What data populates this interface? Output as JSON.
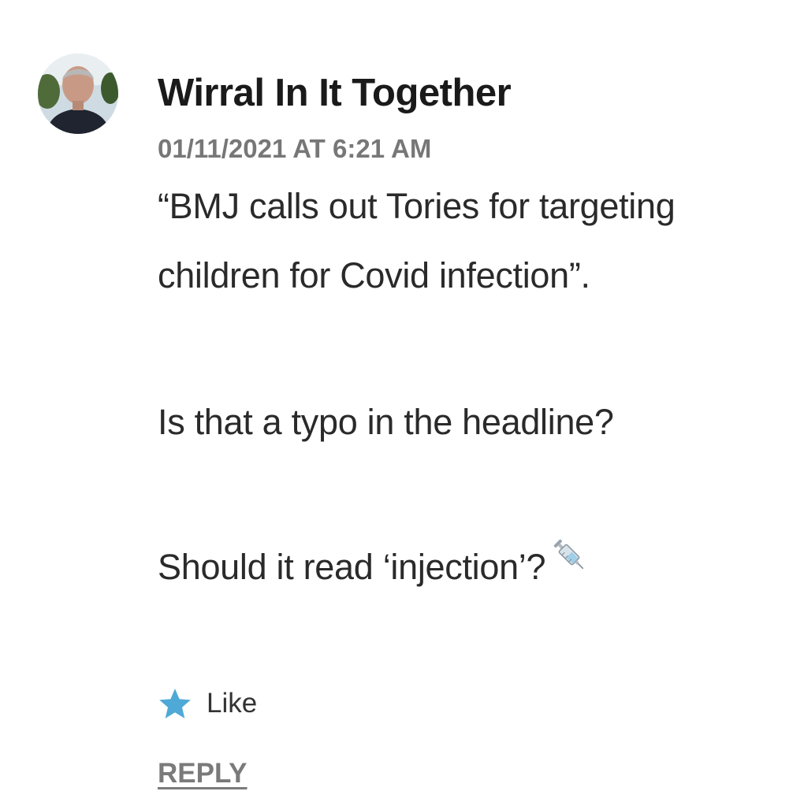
{
  "comment": {
    "author": "Wirral In It Together",
    "timestamp": "01/11/2021 AT 6:21 AM",
    "paragraphs": [
      "“BMJ calls out Tories for targeting children for Covid infection”.",
      "Is that a typo in the headline?",
      "Should it read ‘injection’?"
    ],
    "emoji_icon": "syringe-icon",
    "avatar_icon": "avatar-photo",
    "like_icon": "star-icon",
    "like_label": "Like",
    "reply_label": "REPLY",
    "colors": {
      "like_star": "#4fa9d6",
      "timestamp": "#777777",
      "reply": "#7a7a7a"
    }
  }
}
